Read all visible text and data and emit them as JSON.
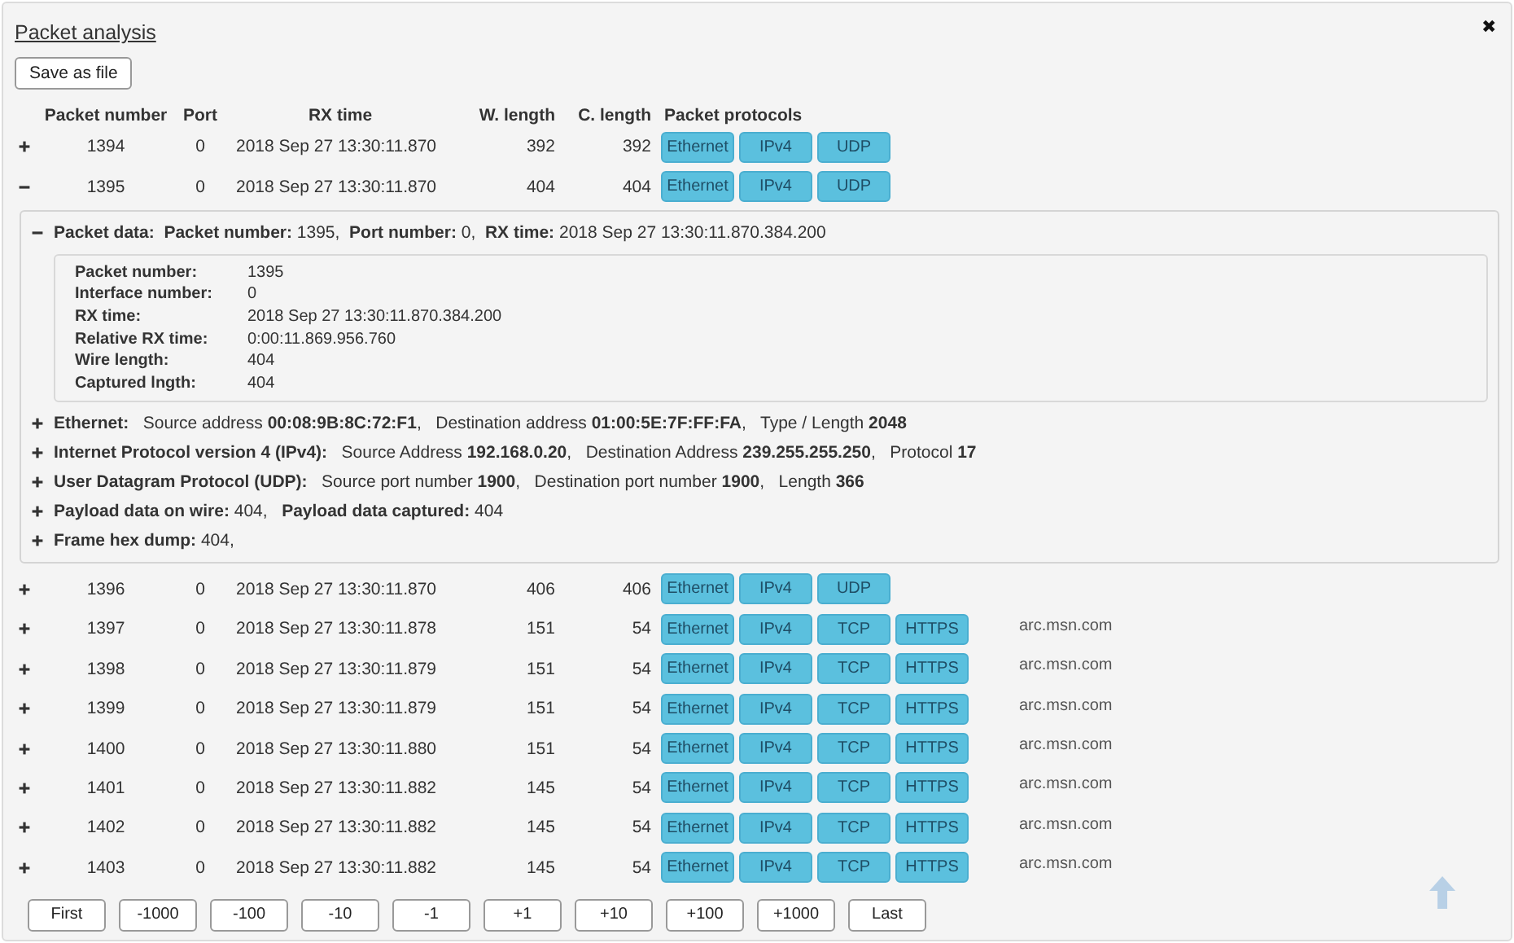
{
  "title": "Packet analysis",
  "close": "✖",
  "save_button": "Save as file",
  "columns": [
    "Packet number",
    "Port",
    "RX time",
    "W. length",
    "C. length",
    "Packet protocols"
  ],
  "rows": [
    {
      "number": "1394",
      "port": "0",
      "rx_time": "2018 Sep 27 13:30:11.870",
      "w_length": "392",
      "c_length": "392",
      "protocols": [
        "Ethernet",
        "IPv4",
        "UDP"
      ],
      "expanded": false
    },
    {
      "number": "1395",
      "port": "0",
      "rx_time": "2018 Sep 27 13:30:11.870",
      "w_length": "404",
      "c_length": "404",
      "protocols": [
        "Ethernet",
        "IPv4",
        "UDP"
      ],
      "expanded": true,
      "details": {
        "header": "**Packet data:**  **Packet number:** 1395,  **Port number:** 0,  **RX time:** 2018 Sep 27 13:30:11.870.384.200",
        "expanded": true,
        "fields": [
          {
            "label": "Packet number:",
            "value": "1395"
          },
          {
            "label": "Interface number:",
            "value": "0"
          },
          {
            "label": "RX time:",
            "value": "2018 Sep 27 13:30:11.870.384.200"
          },
          {
            "label": "Relative RX time:",
            "value": "0:00:11.869.956.760"
          },
          {
            "label": "Wire length:",
            "value": "404"
          },
          {
            "label": "Captured lngth:",
            "value": "404"
          }
        ],
        "sections": [
          {
            "text": "**Ethernet:**   Source address **00:08:9B:8C:72:F1**,   Destination address **01:00:5E:7F:FF:FA**,   Type / Length **2048**",
            "expanded": false
          },
          {
            "text": "**Internet Protocol version 4 (IPv4):**   Source Address **192.168.0.20**,   Destination Address **239.255.255.250**,   Protocol **17**",
            "expanded": false
          },
          {
            "text": "**User Datagram Protocol (UDP):**   Source port number **1900**,   Destination port number **1900**,   Length **366**",
            "expanded": false
          },
          {
            "text": "**Payload data on wire:** 404,   **Payload data captured:** 404",
            "expanded": false
          },
          {
            "text": "**Frame hex dump:** 404,",
            "expanded": false
          }
        ]
      }
    },
    {
      "number": "1396",
      "port": "0",
      "rx_time": "2018 Sep 27 13:30:11.870",
      "w_length": "406",
      "c_length": "406",
      "protocols": [
        "Ethernet",
        "IPv4",
        "UDP"
      ],
      "expanded": false
    },
    {
      "number": "1397",
      "port": "0",
      "rx_time": "2018 Sep 27 13:30:11.878",
      "w_length": "151",
      "c_length": "54",
      "protocols": [
        "Ethernet",
        "IPv4",
        "TCP",
        "HTTPS"
      ],
      "host": "arc.msn.com",
      "expanded": false
    },
    {
      "number": "1398",
      "port": "0",
      "rx_time": "2018 Sep 27 13:30:11.879",
      "w_length": "151",
      "c_length": "54",
      "protocols": [
        "Ethernet",
        "IPv4",
        "TCP",
        "HTTPS"
      ],
      "host": "arc.msn.com",
      "expanded": false
    },
    {
      "number": "1399",
      "port": "0",
      "rx_time": "2018 Sep 27 13:30:11.879",
      "w_length": "151",
      "c_length": "54",
      "protocols": [
        "Ethernet",
        "IPv4",
        "TCP",
        "HTTPS"
      ],
      "host": "arc.msn.com",
      "expanded": false
    },
    {
      "number": "1400",
      "port": "0",
      "rx_time": "2018 Sep 27 13:30:11.880",
      "w_length": "151",
      "c_length": "54",
      "protocols": [
        "Ethernet",
        "IPv4",
        "TCP",
        "HTTPS"
      ],
      "host": "arc.msn.com",
      "expanded": false
    },
    {
      "number": "1401",
      "port": "0",
      "rx_time": "2018 Sep 27 13:30:11.882",
      "w_length": "145",
      "c_length": "54",
      "protocols": [
        "Ethernet",
        "IPv4",
        "TCP",
        "HTTPS"
      ],
      "host": "arc.msn.com",
      "expanded": false
    },
    {
      "number": "1402",
      "port": "0",
      "rx_time": "2018 Sep 27 13:30:11.882",
      "w_length": "145",
      "c_length": "54",
      "protocols": [
        "Ethernet",
        "IPv4",
        "TCP",
        "HTTPS"
      ],
      "host": "arc.msn.com",
      "expanded": false
    },
    {
      "number": "1403",
      "port": "0",
      "rx_time": "2018 Sep 27 13:30:11.882",
      "w_length": "145",
      "c_length": "54",
      "protocols": [
        "Ethernet",
        "IPv4",
        "TCP",
        "HTTPS"
      ],
      "host": "arc.msn.com",
      "expanded": false
    }
  ],
  "paging": [
    "First",
    "-1000",
    "-100",
    "-10",
    "-1",
    "+1",
    "+10",
    "+100",
    "+1000",
    "Last"
  ]
}
